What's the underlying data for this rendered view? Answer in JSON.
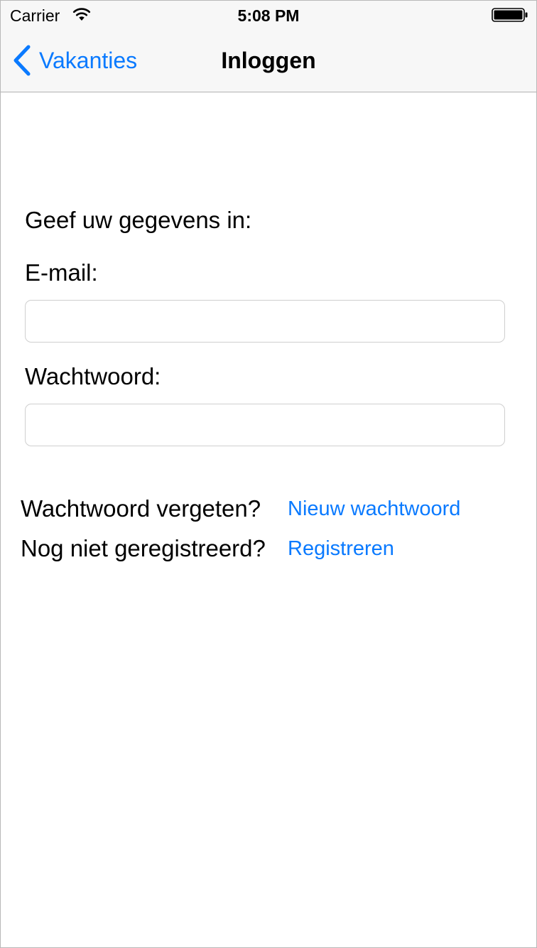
{
  "status_bar": {
    "carrier": "Carrier",
    "time": "5:08 PM",
    "icons": [
      "wifi-icon",
      "battery-icon"
    ]
  },
  "nav": {
    "back_label": "Vakanties",
    "title": "Inloggen",
    "accent_color": "#0a7aff"
  },
  "form": {
    "intro": "Geef uw gegevens in:",
    "email_label": "E-mail:",
    "email_value": "",
    "email_placeholder": "",
    "password_label": "Wachtwoord:",
    "password_value": "",
    "password_placeholder": ""
  },
  "links": {
    "forgot_text": "Wachtwoord vergeten?",
    "forgot_link": "Nieuw wachtwoord",
    "register_text": "Nog niet geregistreerd?",
    "register_link": "Registreren"
  }
}
